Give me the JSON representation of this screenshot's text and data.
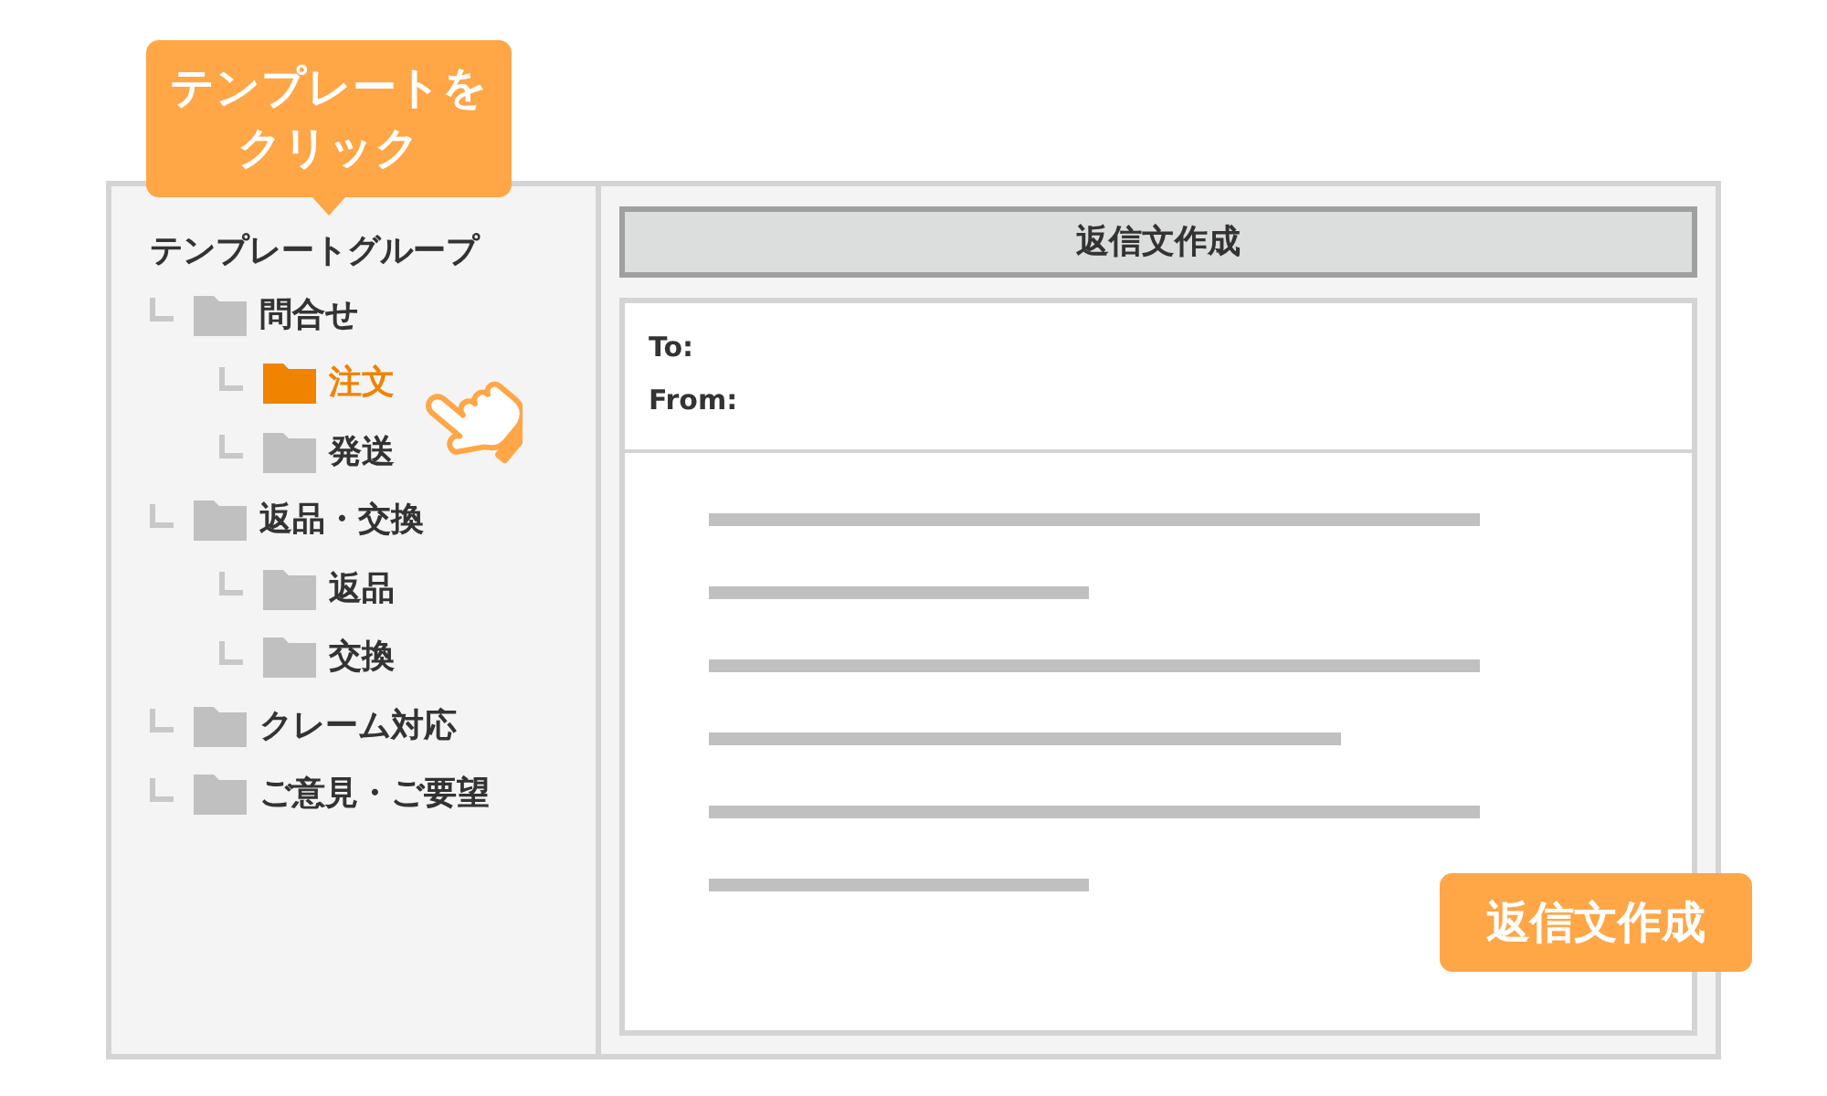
{
  "callout": {
    "lines": [
      "テンプレートを",
      "クリック"
    ]
  },
  "template_tree": {
    "title": "テンプレートグループ",
    "items": [
      {
        "label": "問合せ",
        "selected": false,
        "children": [
          {
            "label": "注文",
            "selected": true
          },
          {
            "label": "発送",
            "selected": false
          }
        ]
      },
      {
        "label": "返品・交換",
        "selected": false,
        "children": [
          {
            "label": "返品",
            "selected": false
          },
          {
            "label": "交換",
            "selected": false
          }
        ]
      },
      {
        "label": "クレーム対応",
        "selected": false
      },
      {
        "label": "ご意見・ご要望",
        "selected": false
      }
    ]
  },
  "compose": {
    "title": "返信文作成",
    "fields": [
      {
        "label": "To:"
      },
      {
        "label": "From:"
      }
    ]
  },
  "create_button": {
    "label": "返信文作成"
  }
}
